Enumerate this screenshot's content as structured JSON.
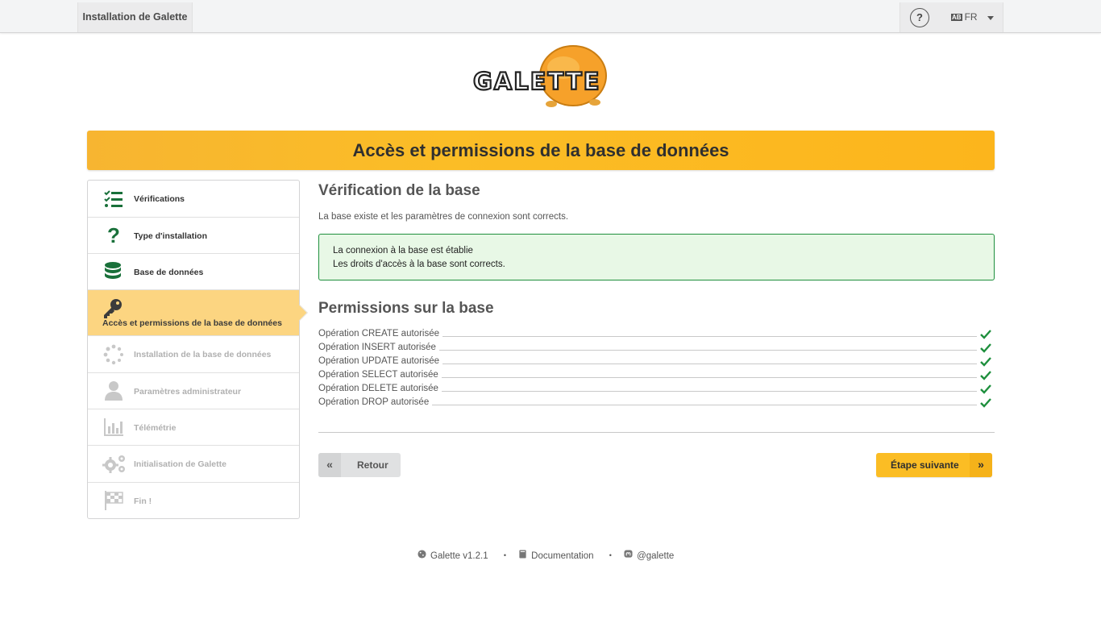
{
  "topbar": {
    "title": "Installation de Galette",
    "help": "?",
    "lang_flag": "AB",
    "lang": "FR"
  },
  "logo": {
    "text": "GALETTE"
  },
  "banner": {
    "title": "Accès et permissions de la base de données"
  },
  "steps": [
    {
      "label": "Vérifications",
      "state": "done",
      "icon": "checklist-icon"
    },
    {
      "label": "Type d'installation",
      "state": "done",
      "icon": "question-icon"
    },
    {
      "label": "Base de données",
      "state": "done",
      "icon": "database-icon"
    },
    {
      "label": "Accès et permissions de la base de données",
      "state": "active",
      "icon": "key-icon"
    },
    {
      "label": "Installation de la base de données",
      "state": "disabled",
      "icon": "spinner-icon"
    },
    {
      "label": "Paramètres administrateur",
      "state": "disabled",
      "icon": "user-icon"
    },
    {
      "label": "Télémétrie",
      "state": "disabled",
      "icon": "bar-chart-icon"
    },
    {
      "label": "Initialisation de Galette",
      "state": "disabled",
      "icon": "cogs-icon"
    },
    {
      "label": "Fin !",
      "state": "disabled",
      "icon": "checkered-flag-icon"
    }
  ],
  "main": {
    "check_title": "Vérification de la base",
    "check_desc": "La base existe et les paramètres de connexion sont corrects.",
    "success": {
      "line1": "La connexion à la base est établie",
      "line2": "Les droits d'accès à la base sont corrects."
    },
    "perms_title": "Permissions sur la base",
    "permissions": [
      "Opération CREATE autorisée",
      "Opération INSERT autorisée",
      "Opération UPDATE autorisée",
      "Opération SELECT autorisée",
      "Opération DELETE autorisée",
      "Opération DROP autorisée"
    ],
    "back_label": "Retour",
    "next_label": "Étape suivante",
    "back_arrow": "«",
    "next_arrow": "»"
  },
  "footer": {
    "version": "Galette v1.2.1",
    "doc": "Documentation",
    "social": "@galette",
    "bullet": "•"
  },
  "colors": {
    "accent": "#fbbd24",
    "active_step": "#fcd581",
    "success_border": "#1e8f3d",
    "success_bg": "#e8f8e6",
    "check_green": "#1e8f3d",
    "step_icon_green": "#19703a"
  }
}
